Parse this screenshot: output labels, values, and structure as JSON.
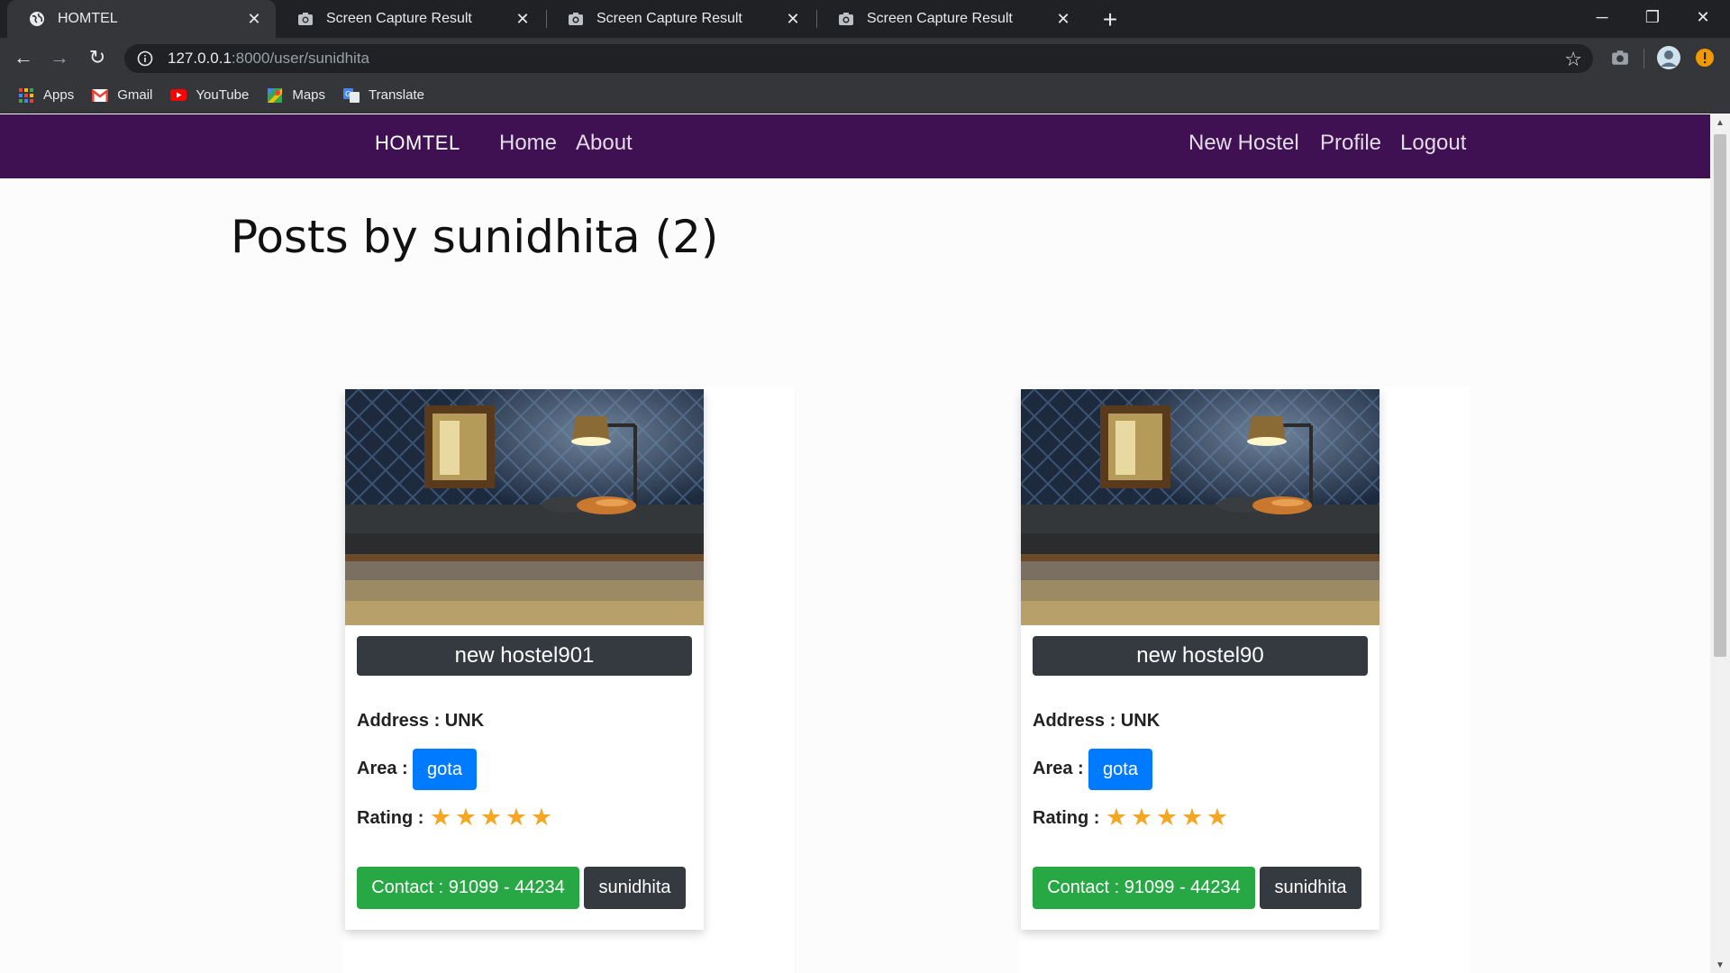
{
  "browser": {
    "tabs": [
      {
        "title": "HOMTEL",
        "active": true,
        "icon": "globe-icon"
      },
      {
        "title": "Screen Capture Result",
        "active": false,
        "icon": "camera-icon"
      },
      {
        "title": "Screen Capture Result",
        "active": false,
        "icon": "camera-icon"
      },
      {
        "title": "Screen Capture Result",
        "active": false,
        "icon": "camera-icon"
      }
    ],
    "url_host": "127.0.0.1",
    "url_rest": ":8000/user/sunidhita",
    "bookmarks": [
      {
        "label": "Apps",
        "icon": "apps-grid-icon"
      },
      {
        "label": "Gmail",
        "icon": "gmail-icon"
      },
      {
        "label": "YouTube",
        "icon": "youtube-icon"
      },
      {
        "label": "Maps",
        "icon": "maps-icon"
      },
      {
        "label": "Translate",
        "icon": "translate-icon"
      }
    ]
  },
  "navbar": {
    "brand": "HOMTEL",
    "left_links": [
      "Home",
      "About"
    ],
    "right_links": [
      "New Hostel",
      "Profile",
      "Logout"
    ],
    "bg_color": "#3f1052"
  },
  "page": {
    "heading": "Posts by sunidhita (2)"
  },
  "posts": [
    {
      "name": "new hostel901",
      "address_label": "Address : UNK",
      "area_label": "Area :",
      "area": "gota",
      "rating_label": "Rating :",
      "rating": 5,
      "contact": "Contact : 91099 - 44234",
      "owner": "sunidhita"
    },
    {
      "name": "new hostel90",
      "address_label": "Address : UNK",
      "area_label": "Area :",
      "area": "gota",
      "rating_label": "Rating :",
      "rating": 5,
      "contact": "Contact : 91099 - 44234",
      "owner": "sunidhita"
    }
  ],
  "colors": {
    "area_badge": "#007bff",
    "contact_button": "#28a745",
    "dark_button": "#343a40",
    "star": "#f5a623"
  }
}
